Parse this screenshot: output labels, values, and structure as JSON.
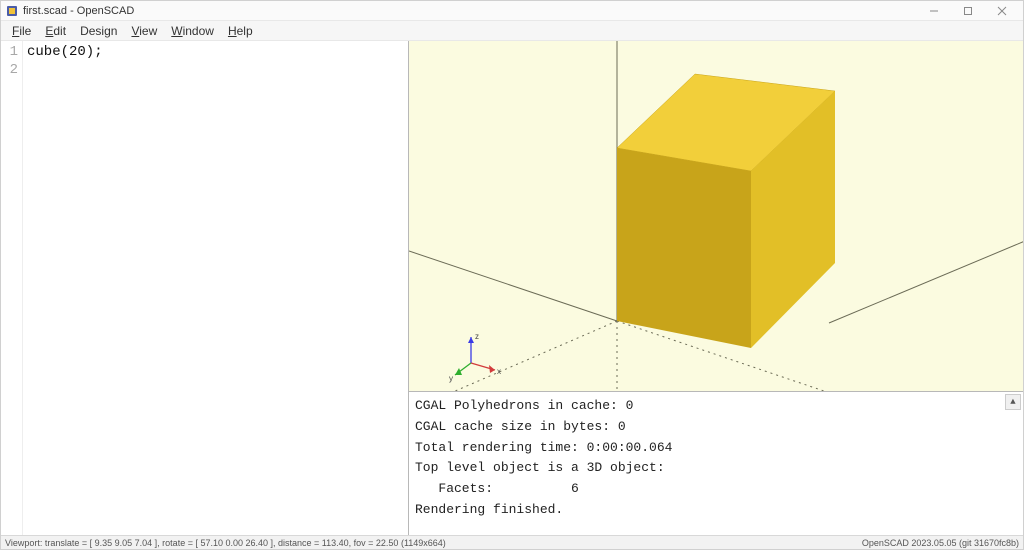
{
  "titlebar": {
    "title": "first.scad - OpenSCAD"
  },
  "menu": {
    "file": "File",
    "edit": "Edit",
    "design": "Design",
    "view": "View",
    "window": "Window",
    "help": "Help"
  },
  "editor": {
    "lines": [
      "cube(20);",
      ""
    ],
    "line_numbers": [
      "1",
      "2"
    ]
  },
  "axis_labels": {
    "x": "x",
    "y": "y",
    "z": "z"
  },
  "console": {
    "l1": "CGAL Polyhedrons in cache: 0",
    "l2": "CGAL cache size in bytes: 0",
    "l3": "Total rendering time: 0:00:00.064",
    "l4": "Top level object is a 3D object:",
    "l5": "   Facets:          6",
    "l6": "Rendering finished."
  },
  "statusbar": {
    "left": "Viewport: translate = [ 9.35 9.05 7.04 ], rotate = [ 57.10 0.00 26.40 ], distance = 113.40, fov = 22.50 (1149x664)",
    "right": "OpenSCAD 2023.05.05 (git 31670fc8b)"
  }
}
